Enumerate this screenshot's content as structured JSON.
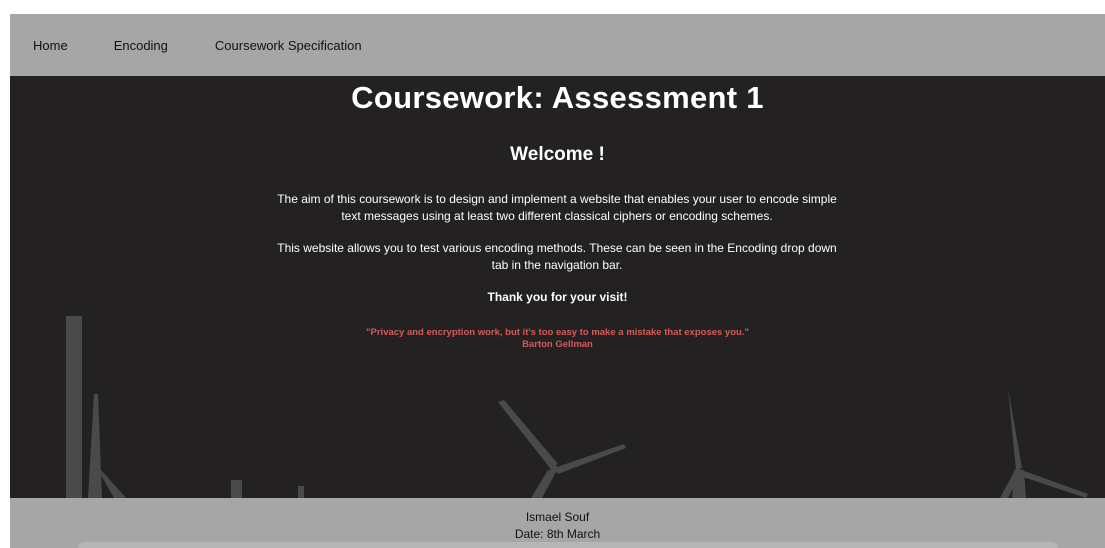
{
  "nav": {
    "items": [
      {
        "label": "Home"
      },
      {
        "label": "Encoding"
      },
      {
        "label": "Coursework Specification"
      }
    ]
  },
  "main": {
    "title": "Coursework: Assessment 1",
    "welcome": "Welcome !",
    "paragraph_aim": "The aim of this coursework is to design and implement a website that enables your user to encode simple text messages using at least two different classical ciphers or encoding schemes.",
    "paragraph_test": "This website allows you to test various encoding methods. These can be seen in the Encoding drop down tab in the navigation bar.",
    "thanks": "Thank you for your visit!",
    "quote": {
      "text": "\"Privacy and encryption work, but it's too easy to make a mistake that exposes you.\"",
      "author": "Barton Gellman"
    }
  },
  "footer": {
    "author": "Ismael Souf",
    "date": "Date: 8th March"
  },
  "colors": {
    "nav_bg": "#a6a6a6",
    "hero_bg": "#232121",
    "quote": "#d65a5a",
    "silhouette": "#4a4a4c"
  },
  "background_icons": [
    "chimney-silhouette",
    "wind-turbine-silhouette"
  ]
}
